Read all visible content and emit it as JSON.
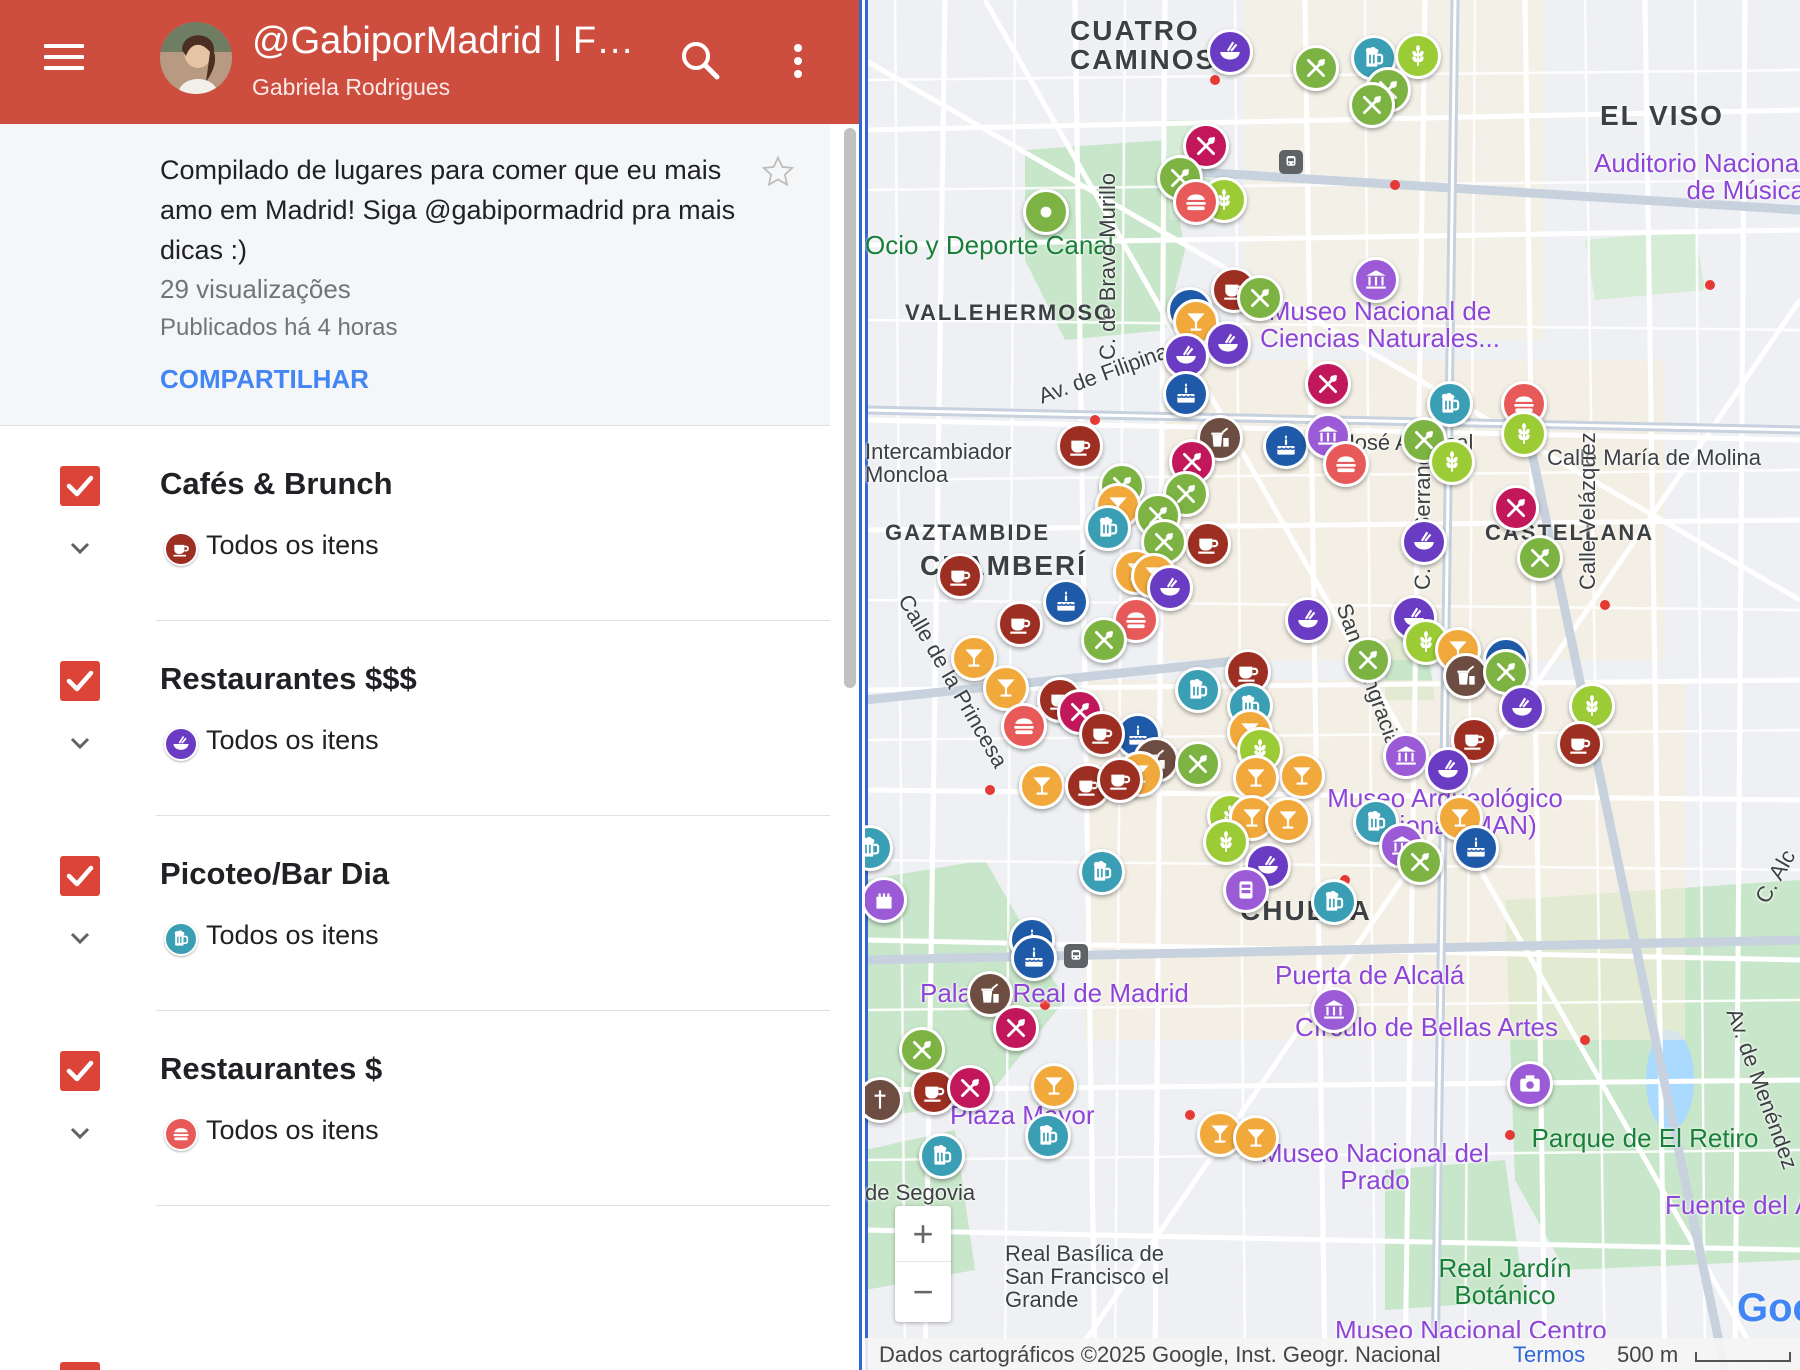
{
  "header": {
    "title": "@GabiporMadrid | FOOD MAP",
    "author": "Gabriela Rodrigues"
  },
  "description": {
    "text": "Compilado de lugares para comer que eu mais amo em Madrid! Siga @gabipormadrid pra mais dicas :)",
    "views": "29 visualizações",
    "published": "Publicados há 4 horas",
    "share_label": "COMPARTILHAR"
  },
  "layers": [
    {
      "name": "Cafés & Brunch",
      "item_label": "Todos os itens",
      "icon": "coffee-icon",
      "color": "#9c2e22"
    },
    {
      "name": "Restaurantes $$$",
      "item_label": "Todos os itens",
      "icon": "bowl-icon",
      "color": "#6a3bc3"
    },
    {
      "name": "Picoteo/Bar Dia",
      "item_label": "Todos os itens",
      "icon": "beer-icon",
      "color": "#3a9fb4"
    },
    {
      "name": "Restaurantes $",
      "item_label": "Todos os itens",
      "icon": "burger-icon",
      "color": "#e85a5a"
    }
  ],
  "map": {
    "labels": {
      "cuatro_caminos": "CUATRO CAMINOS",
      "el_viso": "EL VISO",
      "auditorio": "Auditorio Nacional de Música",
      "canal": "Ocio y Deporte Canal",
      "vallehermoso": "VALLEHERMOSO",
      "museo_ciencias": "Museo Nacional de Ciencias Naturales...",
      "av_filipinas": "Av. de Filipinas",
      "bravo_murillo": "C. de Bravo Murillo",
      "jose_abascal": "C. de José Abascal",
      "intercambiador": "Intercambiador Moncloa",
      "calle_maria_molina": "Calle María de Molina",
      "gaztambide": "GAZTAMBIDE",
      "chamberi": "CHAMBERÍ",
      "castellana": "CASTELLANA",
      "calle_princesa": "Calle de la Princesa",
      "santa_engracia": "Santa Engracia",
      "serrano": "C. de Serrano",
      "velazquez": "Calle Velázquez",
      "museo_arqueologico": "Museo Arqueológico Nacional (MAN)",
      "justicia": "CHUECA",
      "palacio_real": "Palacio Real de Madrid",
      "puerta_alcala": "Puerta de Alcalá",
      "bellas_artes": "Círculo de Bellas Artes",
      "plaza_mayor": "Plaza Mayor",
      "museo_prado": "Museo Nacional del Prado",
      "parque_retiro": "Parque de El Retiro",
      "fuente": "Fuente del Á",
      "segovia": "de Segovia",
      "san_francisco": "Real Basílica de San Francisco el Grande",
      "jardin_botanico": "Real Jardín Botánico",
      "museo_centro": "Museo Nacional Centro",
      "av_menendez": "Av. de Menéndez",
      "calle_alcala": "C. Alc"
    },
    "attribution": "Dados cartográficos ©2025 Google, Inst. Geogr. Nacional",
    "terms": "Termos",
    "scale": "500 m",
    "google": "Google",
    "zoom_in": "+",
    "zoom_out": "−",
    "colors": {
      "coffee": "#9c2e22",
      "bowl": "#6a3bc3",
      "beer": "#3a9fb4",
      "burger": "#e85a5a",
      "cutlery_green": "#7cb342",
      "cutlery_red": "#c2185b",
      "cocktail": "#f2a93b",
      "cake": "#1e5aa8",
      "wheat": "#9ccc35",
      "takeaway": "#6d4c41",
      "purple_poi": "#9c5bd6"
    }
  }
}
